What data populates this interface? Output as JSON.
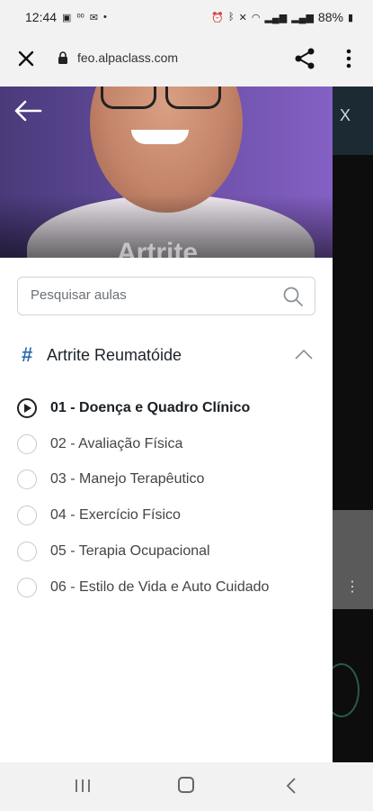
{
  "status_bar": {
    "time": "12:44",
    "battery": "88%",
    "left_icons": [
      "gallery-icon",
      "voicemail-icon",
      "mail-icon",
      "dot-icon"
    ],
    "right_icons": [
      "alarm-icon",
      "bluetooth-icon",
      "mute-icon",
      "wifi-icon",
      "signal-icon",
      "signal-icon",
      "battery-icon"
    ]
  },
  "browser": {
    "url": "feo.alpaclass.com"
  },
  "hero": {
    "title_peek": "Artrite"
  },
  "search": {
    "placeholder": "Pesquisar aulas"
  },
  "module": {
    "hash": "#",
    "title": "Artrite Reumatóide"
  },
  "lessons": [
    {
      "label": "01 - Doença e Quadro Clínico",
      "active": true
    },
    {
      "label": "02 - Avaliação Física",
      "active": false
    },
    {
      "label": "03 - Manejo Terapêutico",
      "active": false
    },
    {
      "label": "04 - Exercício Físico",
      "active": false
    },
    {
      "label": "05 - Terapia Ocupacional",
      "active": false
    },
    {
      "label": "06 - Estilo de Vida e Auto Cuidado",
      "active": false
    }
  ],
  "background_page": {
    "close_glyph": "X",
    "more_glyph": "⋮"
  },
  "colors": {
    "accent": "#2b6cb0",
    "hero_purple": "#6a4fa6",
    "text_dark": "#1e2328"
  }
}
